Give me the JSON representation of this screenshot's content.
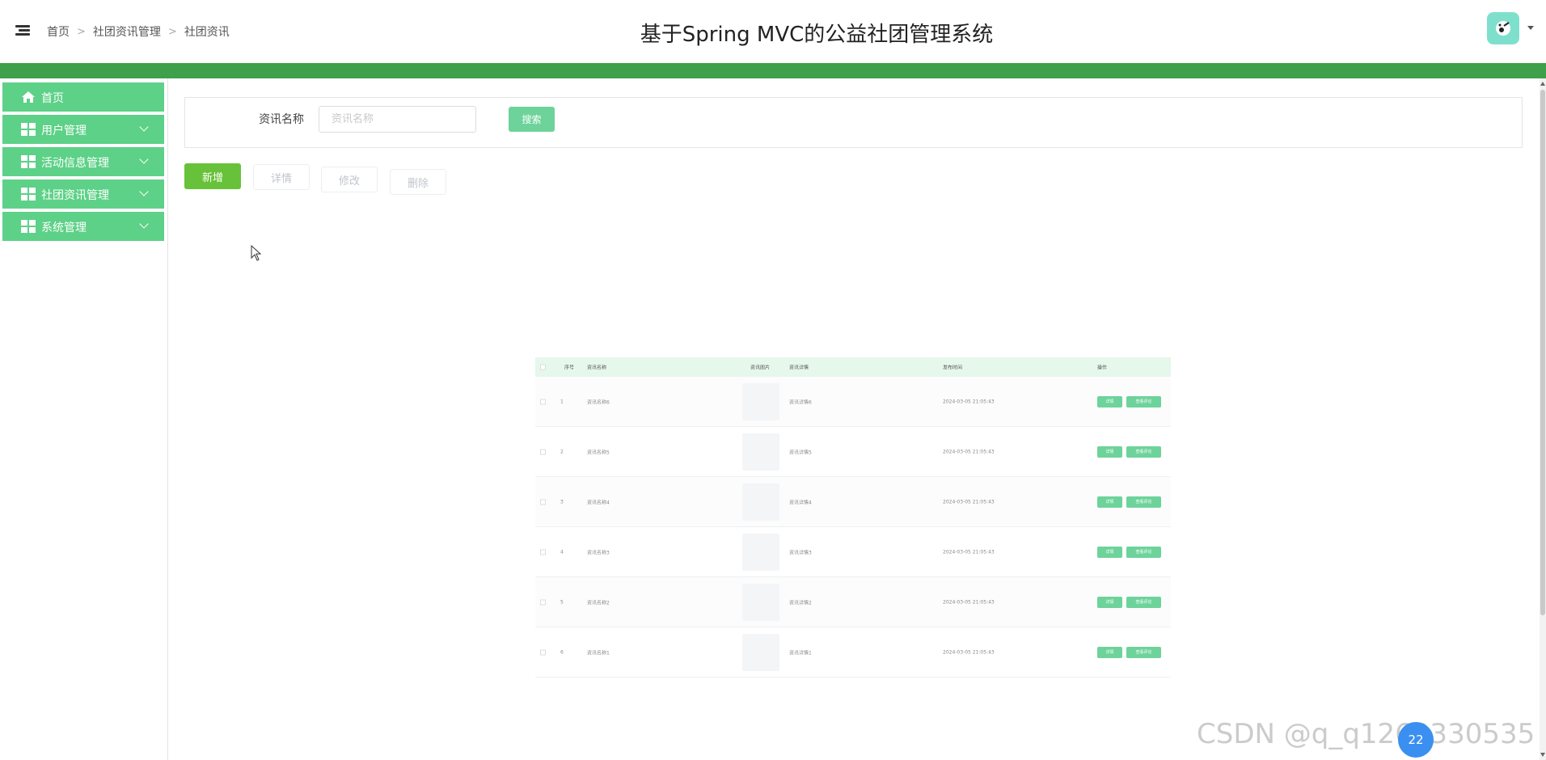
{
  "header": {
    "title": "基于Spring MVC的公益社团管理系统",
    "breadcrumb": [
      "首页",
      "社团资讯管理",
      "社团资讯"
    ]
  },
  "colors": {
    "brand_green": "#3ea04a",
    "menu_green": "#5dd187",
    "add_button": "#67c23a",
    "avatar_bg": "#7ee0cc"
  },
  "sidebar": {
    "items": [
      {
        "label": "首页",
        "icon": "home-icon"
      },
      {
        "label": "用户管理",
        "icon": "grid-icon"
      },
      {
        "label": "活动信息管理",
        "icon": "grid-icon"
      },
      {
        "label": "社团资讯管理",
        "icon": "grid-icon"
      },
      {
        "label": "系统管理",
        "icon": "grid-icon"
      }
    ]
  },
  "search": {
    "label": "资讯名称",
    "placeholder": "资讯名称",
    "button": "搜索"
  },
  "actions": {
    "add": "新增",
    "detail": "详情",
    "edit": "修改",
    "delete": "删除"
  },
  "table": {
    "headers": [
      "序号",
      "资讯名称",
      "资讯图片",
      "资讯详情",
      "发布时间",
      "操作"
    ],
    "row_buttons": [
      "详情",
      "查看评论"
    ],
    "rows": [
      {
        "index": "1",
        "name": "资讯名称6",
        "detail": "资讯详情6",
        "time": "2024-03-05 21:05:43"
      },
      {
        "index": "2",
        "name": "资讯名称5",
        "detail": "资讯详情5",
        "time": "2024-03-05 21:05:43"
      },
      {
        "index": "3",
        "name": "资讯名称4",
        "detail": "资讯详情4",
        "time": "2024-03-05 21:05:43"
      },
      {
        "index": "4",
        "name": "资讯名称3",
        "detail": "资讯详情3",
        "time": "2024-03-05 21:05:43"
      },
      {
        "index": "5",
        "name": "资讯名称2",
        "detail": "资讯详情2",
        "time": "2024-03-05 21:05:43"
      },
      {
        "index": "6",
        "name": "资讯名称1",
        "detail": "资讯详情1",
        "time": "2024-03-05 21:05:43"
      }
    ]
  },
  "watermark": "CSDN @q_q1262330535",
  "bubble": "22"
}
